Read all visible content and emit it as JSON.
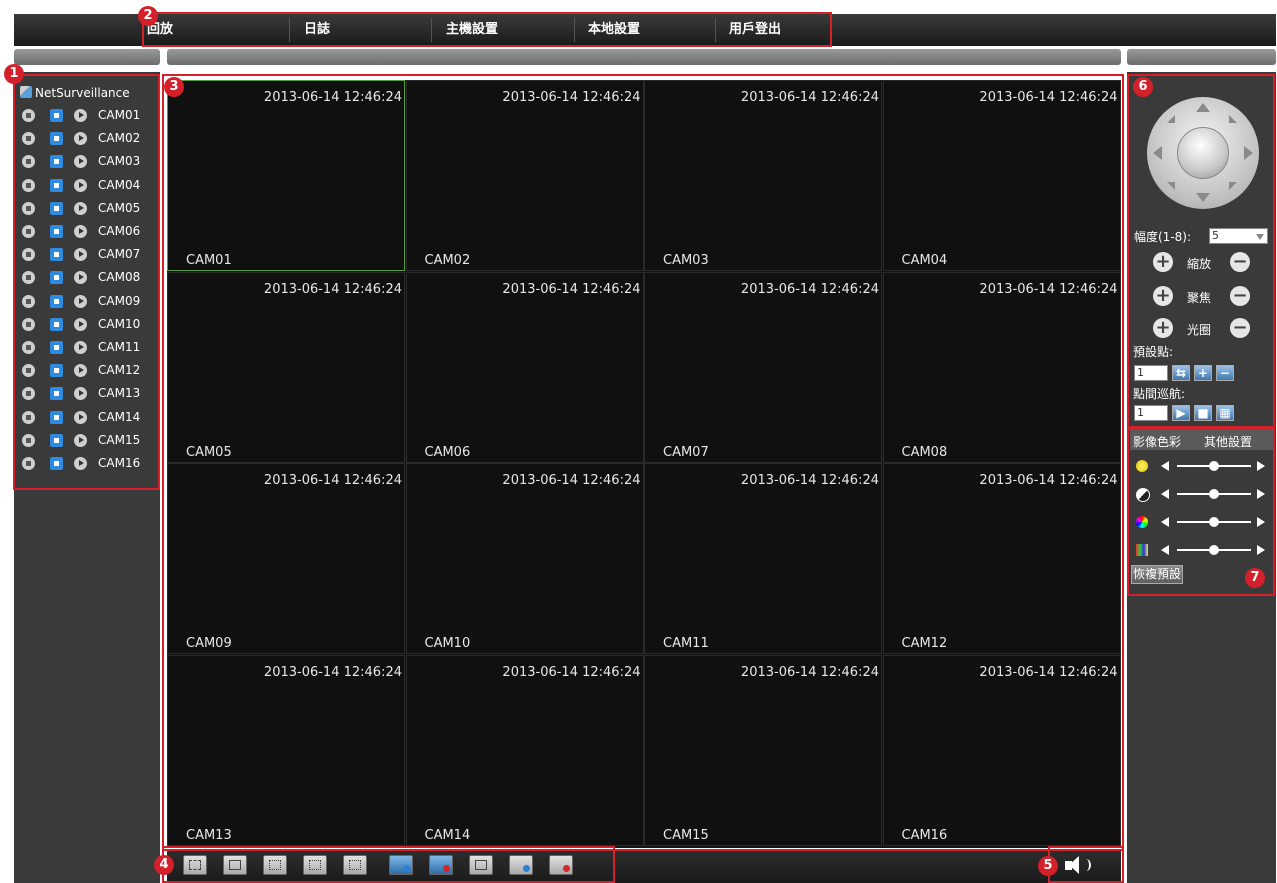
{
  "menu": {
    "items": [
      "回放",
      "日誌",
      "主機設置",
      "本地設置",
      "用戶登出"
    ]
  },
  "tree": {
    "root_label": "NetSurveillance",
    "cameras": [
      "CAM01",
      "CAM02",
      "CAM03",
      "CAM04",
      "CAM05",
      "CAM06",
      "CAM07",
      "CAM08",
      "CAM09",
      "CAM10",
      "CAM11",
      "CAM12",
      "CAM13",
      "CAM14",
      "CAM15",
      "CAM16"
    ]
  },
  "grid": {
    "timestamp": "2013-06-14 12:46:24",
    "tiles": [
      {
        "name": "CAM01",
        "ts": "2013-06-14 12:46:24"
      },
      {
        "name": "CAM02",
        "ts": "2013-06-14 12:46:24"
      },
      {
        "name": "CAM03",
        "ts": "2013-06-14 12:46:24"
      },
      {
        "name": "CAM04",
        "ts": "2013-06-14 12:46:24"
      },
      {
        "name": "CAM05",
        "ts": "2013-06-14 12:46:24"
      },
      {
        "name": "CAM06",
        "ts": "2013-06-14 12:46:24"
      },
      {
        "name": "CAM07",
        "ts": "2013-06-14 12:46:24"
      },
      {
        "name": "CAM08",
        "ts": "2013-06-14 12:46:24"
      },
      {
        "name": "CAM09",
        "ts": "2013-06-14 12:46:24"
      },
      {
        "name": "CAM10",
        "ts": "2013-06-14 12:46:24"
      },
      {
        "name": "CAM11",
        "ts": "2013-06-14 12:46:24"
      },
      {
        "name": "CAM12",
        "ts": "2013-06-14 12:46:24"
      },
      {
        "name": "CAM13",
        "ts": "2013-06-14 12:46:24"
      },
      {
        "name": "CAM14",
        "ts": "2013-06-14 12:46:24"
      },
      {
        "name": "CAM15",
        "ts": "2013-06-14 12:46:24"
      },
      {
        "name": "CAM16",
        "ts": "2013-06-14 12:46:24"
      }
    ]
  },
  "ptz": {
    "step_label": "幅度(1-8):",
    "step_value": "5",
    "zoom_label": "縮放",
    "focus_label": "聚焦",
    "iris_label": "光圈",
    "preset_label": "預設點:",
    "preset_value": "1",
    "tour_label": "點間巡航:",
    "tour_value": "1"
  },
  "color": {
    "tab_image": "影像色彩",
    "tab_other": "其他設置",
    "restore_label": "恢複預設",
    "sliders": [
      {
        "icon": "brightness-icon",
        "level": 0.5
      },
      {
        "icon": "contrast-icon",
        "level": 0.5
      },
      {
        "icon": "saturation-icon",
        "level": 0.5
      },
      {
        "icon": "hue-icon",
        "level": 0.5
      }
    ]
  },
  "annotations": [
    "1",
    "2",
    "3",
    "4",
    "5",
    "6",
    "7"
  ],
  "accent_colors": {
    "annotation": "#d3202a",
    "selected_tile": "#5b9b3e"
  }
}
